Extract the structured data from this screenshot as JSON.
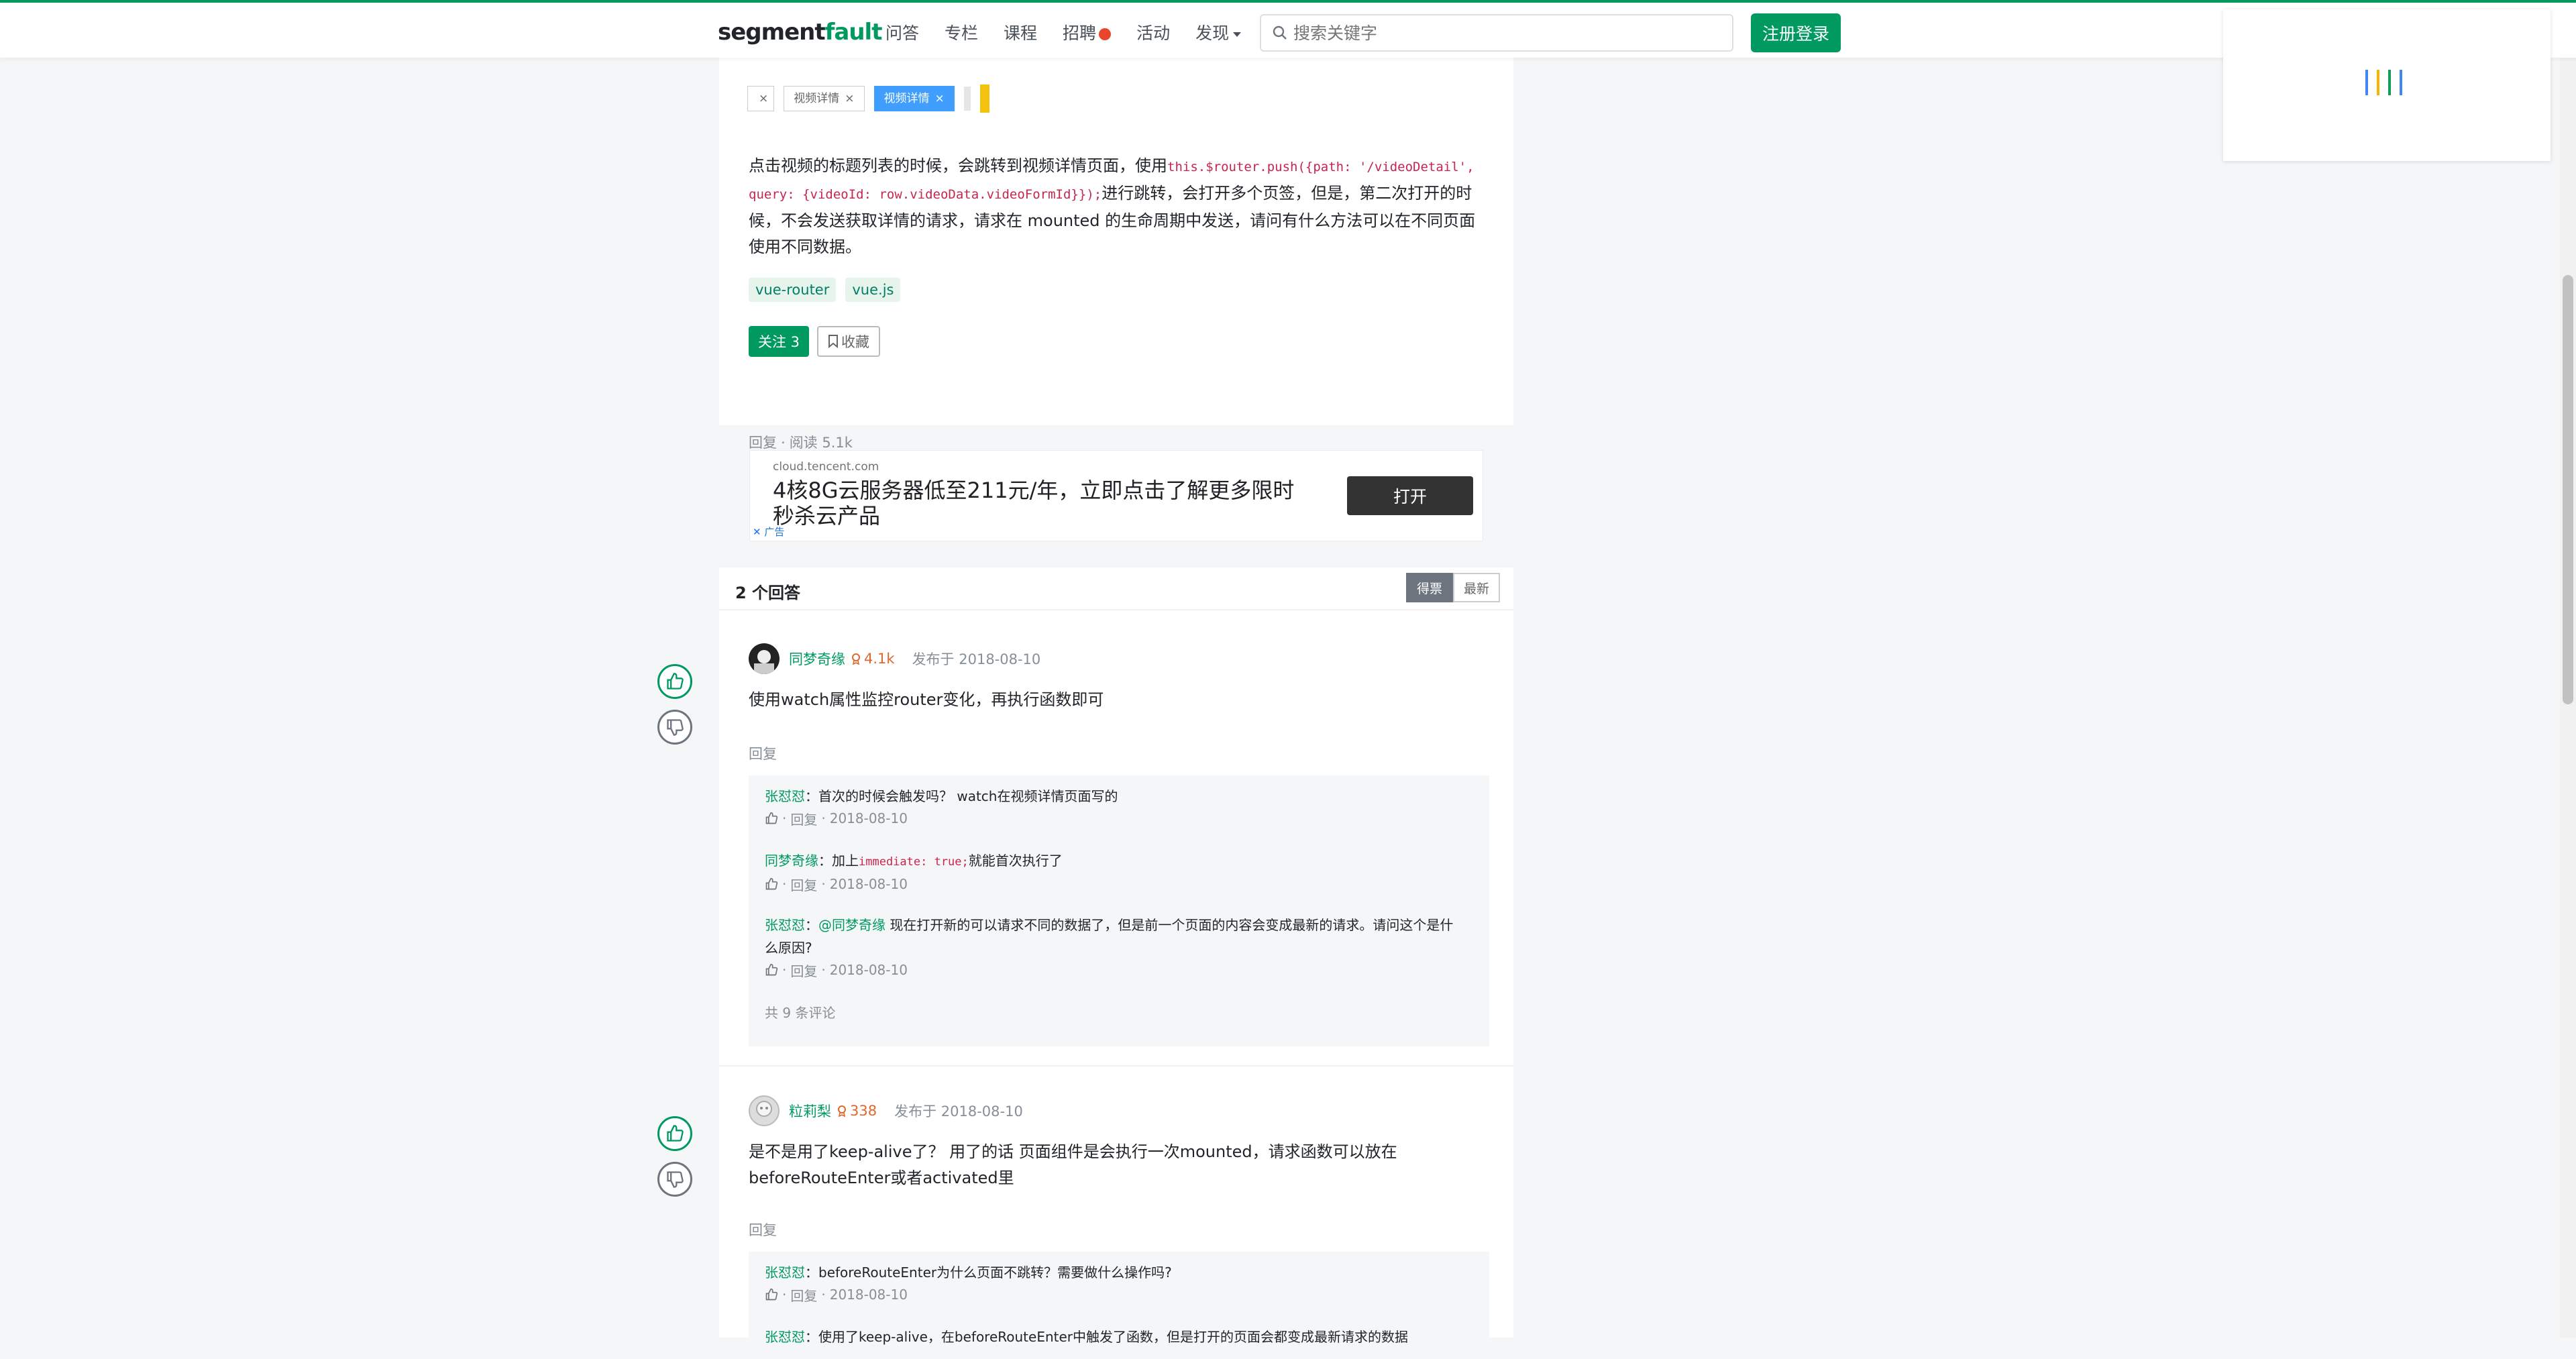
{
  "header": {
    "logo_part1": "segment",
    "logo_part2": "fault",
    "nav": [
      "问答",
      "专栏",
      "课程",
      "招聘",
      "活动",
      "发现"
    ],
    "search_placeholder": "搜索关键字",
    "login_label": "注册登录",
    "brand_color": "#009a61"
  },
  "question": {
    "tabs": [
      "视频详情",
      "视频详情"
    ],
    "tab_partial": "",
    "tab_close": "×",
    "text_before": "点击视频的标题列表的时候，会跳转到视频详情页面，使用",
    "code": "this.$router.push({path: '/videoDetail', query: {videoId: row.videoData.videoFormId}});",
    "text_after": "进行跳转，会打开多个页签，但是，第二次打开的时候，不会发送获取详情的请求，请求在 mounted 的生命周期中发送，请问有什么方法可以在不同页面使用不同数据。",
    "tags": [
      "vue-router",
      "vue.js"
    ],
    "follow_label": "关注 3",
    "collect_label": "收藏",
    "meta_reply": "回复",
    "meta_dot": "·",
    "meta_reads": "阅读 5.1k"
  },
  "ad": {
    "domain": "cloud.tencent.com",
    "title": "4核8G云服务器低至211元/年，立即点击了解更多限时秒杀云产品",
    "button": "打开",
    "label": "广告"
  },
  "answers": {
    "heading": "2 个回答",
    "sort_votes": "得票",
    "sort_newest": "最新",
    "items": [
      {
        "author": "同梦奇缘",
        "rep": "4.1k",
        "posted": "发布于 2018-08-10",
        "body": "使用watch属性监控router变化，再执行函数即可",
        "reply": "回复",
        "comments": [
          {
            "user": "张怼怼",
            "sep": "：",
            "text": "首次的时候会触发吗？ watch在视频详情页面写的",
            "reply": "回复",
            "date": "2018-08-10"
          },
          {
            "user": "同梦奇缘",
            "sep": "：",
            "text_before": "加上",
            "code": "immediate: true;",
            "text_after": "就能首次执行了",
            "reply": "回复",
            "date": "2018-08-10"
          },
          {
            "user": "张怼怼",
            "sep": "：",
            "mention": "@同梦奇缘",
            "text": " 现在打开新的可以请求不同的数据了，但是前一个页面的内容会变成最新的请求。请问这个是什么原因?",
            "reply": "回复",
            "date": "2018-08-10"
          }
        ],
        "total": "共 9 条评论"
      },
      {
        "author": "粒莉梨",
        "rep": "338",
        "posted": "发布于 2018-08-10",
        "body": "是不是用了keep-alive了？ 用了的话 页面组件是会执行一次mounted，请求函数可以放在beforeRouteEnter或者activated里",
        "reply": "回复",
        "comments": [
          {
            "user": "张怼怼",
            "sep": "：",
            "text": "beforeRouteEnter为什么页面不跳转？需要做什么操作吗?",
            "reply": "回复",
            "date": "2018-08-10"
          },
          {
            "user": "张怼怼",
            "sep": "：",
            "text": "使用了keep-alive，在beforeRouteEnter中触发了函数，但是打开的页面会都变成最新请求的数据",
            "reply": "",
            "date": ""
          }
        ]
      }
    ]
  },
  "dot": "·"
}
